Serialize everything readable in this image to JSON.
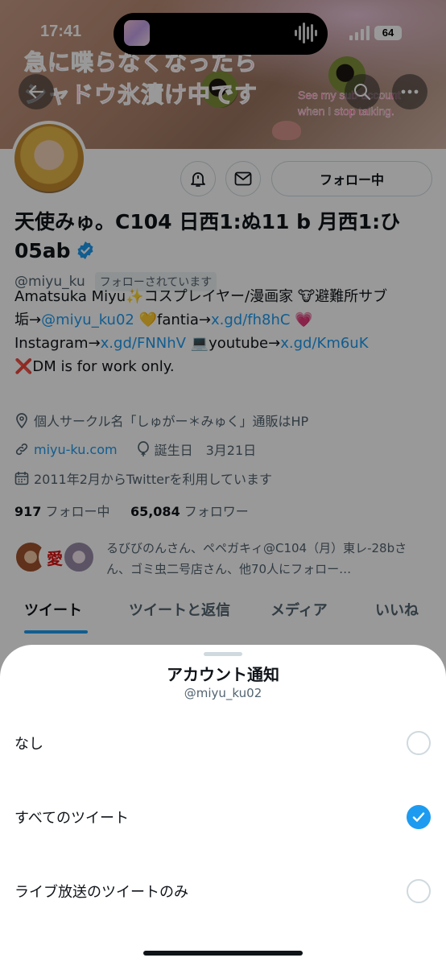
{
  "status_bar": {
    "time": "17:41",
    "battery": "64"
  },
  "header": {
    "banner_text_jp": "急に喋らなくなったら\nシャドウ氷漬け中です",
    "banner_text_en": "See my sub-account\nwhen I stop talking."
  },
  "profile": {
    "follow_button": "フォロー中",
    "display_name": "天使みゅ。C104 日西1:ぬ11 b 月西1:ひ05ab",
    "handle": "@miyu_ku",
    "follows_you": "フォローされています",
    "bio": {
      "line1_text": "Amatsuka Miyu✨コスプレイヤー/漫画家 🐮避難所サブ",
      "line2_prefix": "垢→",
      "line2_link1": "@miyu_ku02",
      "line2_mid": " 💛fantia→",
      "line2_link2": "x.gd/fh8hC",
      "line2_suffix": " 💗",
      "line3_prefix": "Instagram→",
      "line3_link1": "x.gd/FNNhV",
      "line3_mid": " 💻youtube→",
      "line3_link2": "x.gd/Km6uK",
      "line4": "❌DM is for work only."
    },
    "location": "個人サークル名「しゅがー＊みゅく」通販はHP",
    "website": "miyu-ku.com",
    "birthday": "誕生日　3月21日",
    "joined": "2011年2月からTwitterを利用しています",
    "following_count": "917",
    "following_label": "フォロー中",
    "followers_count": "65,084",
    "followers_label": "フォロワー",
    "mutuals_text": "るびびのんさん、ペペガキィ@C104（月）東レ-28bさん、ゴミ虫二号店さん、他70人にフォロー…"
  },
  "tabs": [
    {
      "label": "ツイート"
    },
    {
      "label": "ツイートと返信"
    },
    {
      "label": "メディア"
    },
    {
      "label": "いいね"
    }
  ],
  "sheet": {
    "title": "アカウント通知",
    "subtitle": "@miyu_ku02",
    "options": [
      {
        "label": "なし",
        "selected": false
      },
      {
        "label": "すべてのツイート",
        "selected": true
      },
      {
        "label": "ライブ放送のツイートのみ",
        "selected": false
      }
    ]
  },
  "colors": {
    "accent": "#1d9bf0",
    "text": "#0f1419",
    "secondary": "#536471"
  }
}
